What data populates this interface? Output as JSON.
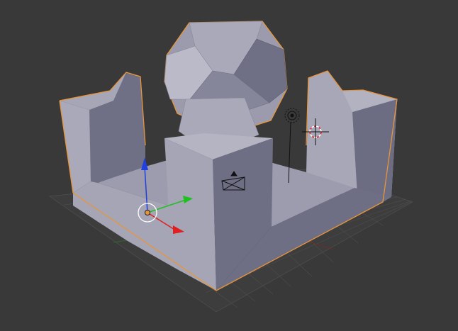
{
  "viewport": {
    "background": "#393939",
    "grid_color": "#4a4a4a",
    "mesh_face_light": "#a6a6b6",
    "mesh_face_mid": "#8e8ea0",
    "mesh_face_dark": "#6f7085",
    "selection_outline": "#e8953a",
    "axis_x_color": "#e02020",
    "axis_y_color": "#20c020",
    "axis_z_color": "#2040e0"
  },
  "objects": {
    "selected_mesh": "selected-mesh-object",
    "lamp": "lamp-object",
    "camera": "camera-object",
    "cursor": "3d-cursor"
  },
  "gizmo": {
    "type": "translate-manipulator",
    "axes": [
      "x",
      "y",
      "z"
    ]
  }
}
